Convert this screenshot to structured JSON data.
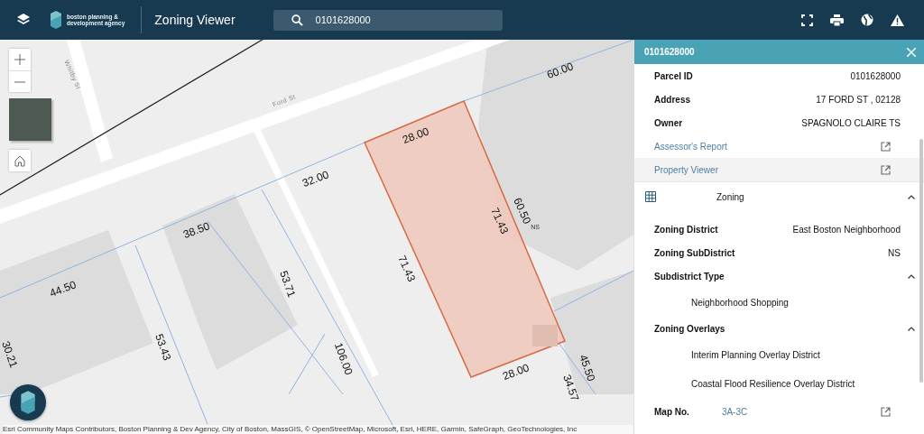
{
  "header": {
    "logo_text": "boston planning &\ndevelopment agency",
    "title": "Zoning Viewer",
    "search": {
      "value": "0101628000"
    }
  },
  "map": {
    "labels": [
      {
        "text": "Whitby St",
        "kind": "street"
      },
      {
        "text": "Ford St",
        "kind": "street"
      },
      {
        "text": "60.00",
        "kind": "dimension"
      },
      {
        "text": "28.00",
        "kind": "dimension"
      },
      {
        "text": "32.00",
        "kind": "dimension"
      },
      {
        "text": "60.50",
        "kind": "dimension"
      },
      {
        "text": "NS",
        "kind": "zone"
      },
      {
        "text": "71.43",
        "kind": "dimension"
      },
      {
        "text": "71.43",
        "kind": "dimension"
      },
      {
        "text": "38.50",
        "kind": "dimension"
      },
      {
        "text": "53.71",
        "kind": "dimension"
      },
      {
        "text": "44.50",
        "kind": "dimension"
      },
      {
        "text": "53.43",
        "kind": "dimension"
      },
      {
        "text": "30.21",
        "kind": "dimension"
      },
      {
        "text": "106.00",
        "kind": "dimension"
      },
      {
        "text": "28.00",
        "kind": "dimension"
      },
      {
        "text": "45.50",
        "kind": "dimension"
      },
      {
        "text": "34.57",
        "kind": "dimension"
      }
    ],
    "attribution": "Esri Community Maps Contributors, Boston Planning & Dev Agency, City of Boston, MassGIS, © OpenStreetMap, Microsoft, Esri, HERE, Garmin, SafeGraph, GeoTechnologies, Inc"
  },
  "panel": {
    "title": "0101628000",
    "fields": [
      {
        "label": "Parcel ID",
        "value": "0101628000"
      },
      {
        "label": "Address",
        "value": "17 FORD ST , 02128"
      },
      {
        "label": "Owner",
        "value": "SPAGNOLO CLAIRE TS"
      }
    ],
    "links": [
      {
        "label": "Assessor's Report",
        "highlighted": false
      },
      {
        "label": "Property Viewer",
        "highlighted": true
      }
    ],
    "zoning": {
      "title": "Zoning",
      "expanded": true,
      "fields": [
        {
          "label": "Zoning District",
          "value": "East Boston Neighborhood"
        },
        {
          "label": "Zoning SubDistrict",
          "value": "NS"
        }
      ],
      "groups": [
        {
          "title": "Subdistrict Type",
          "expanded": true,
          "items": [
            "Neighborhood Shopping"
          ]
        },
        {
          "title": "Zoning Overlays",
          "expanded": true,
          "items": [
            "Interim Planning Overlay District",
            "Coastal Flood Resilience Overlay District"
          ]
        }
      ],
      "map_no": {
        "label": "Map No.",
        "value": "3A-3C"
      }
    }
  }
}
